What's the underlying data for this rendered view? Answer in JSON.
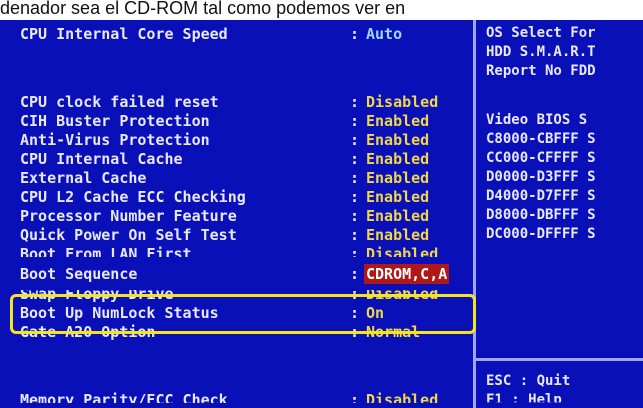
{
  "caption": "denador sea el CD-ROM tal como podemos ver en",
  "settings": [
    {
      "label": "CPU Internal Core Speed",
      "value": "Auto"
    },
    {
      "label": "CPU clock failed reset",
      "value": "Disabled"
    },
    {
      "label": "CIH Buster Protection",
      "value": "Enabled"
    },
    {
      "label": "Anti-Virus Protection",
      "value": "Enabled"
    },
    {
      "label": "CPU Internal Cache",
      "value": "Enabled"
    },
    {
      "label": "External Cache",
      "value": "Enabled"
    },
    {
      "label": "CPU L2 Cache ECC Checking",
      "value": "Enabled"
    },
    {
      "label": "Processor Number Feature",
      "value": "Enabled"
    },
    {
      "label": "Quick Power On Self Test",
      "value": "Enabled"
    },
    {
      "label": "Boot From LAN First",
      "value": "Disabled"
    },
    {
      "label": "Boot Sequence",
      "value": "CDROM,C,A"
    },
    {
      "label": "Swap Floppy Drive",
      "value": "Disabled"
    },
    {
      "label": "Boot Up NumLock Status",
      "value": "On"
    },
    {
      "label": "Gate A20 Option",
      "value": "Normal"
    },
    {
      "label": "Memory Parity/ECC Check",
      "value": "Disabled"
    }
  ],
  "colon": ":",
  "right_panel": {
    "top_lines": [
      "OS Select For",
      "HDD S.M.A.R.T",
      "Report No FDD"
    ],
    "video_bios_header": "Video  BIOS S",
    "ranges": [
      "C8000-CBFFF S",
      "CC000-CFFFF S",
      "D0000-D3FFF S",
      "D4000-D7FFF S",
      "D8000-DBFFF S",
      "DC000-DFFFF S"
    ],
    "keys": [
      "ESC : Quit",
      "F1  : Help"
    ]
  },
  "colors": {
    "background": "#0a10b8",
    "value": "#f2d64a",
    "label": "#e8e8ff",
    "selected": "#b01818",
    "highlight": "#f4e61a"
  }
}
